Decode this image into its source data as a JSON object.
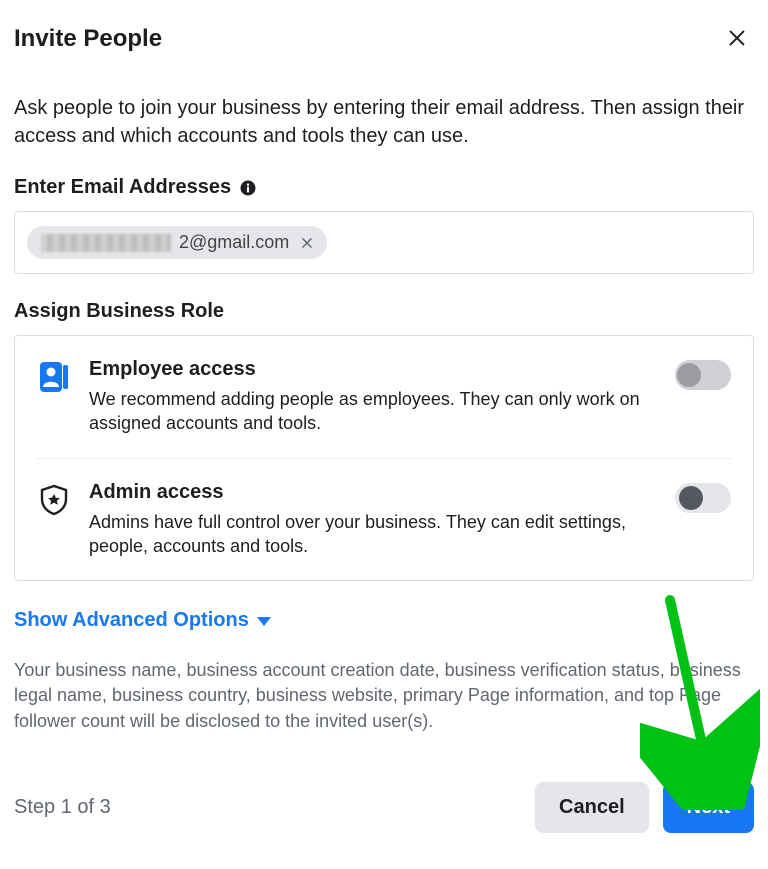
{
  "header": {
    "title": "Invite People"
  },
  "description": "Ask people to join your business by entering their email address. Then assign their access and which accounts and tools they can use.",
  "email_section": {
    "label": "Enter Email Addresses",
    "chip_suffix": "2@gmail.com"
  },
  "role_section": {
    "label": "Assign Business Role",
    "employee": {
      "title": "Employee access",
      "desc": "We recommend adding people as employees. They can only work on assigned accounts and tools."
    },
    "admin": {
      "title": "Admin access",
      "desc": "Admins have full control over your business. They can edit settings, people, accounts and tools."
    }
  },
  "advanced_label": "Show Advanced Options",
  "disclosure": "Your business name, business account creation date, business verification status, business legal name, business country, business website, primary Page information, and top Page follower count will be disclosed to the invited user(s).",
  "footer": {
    "step": "Step 1 of 3",
    "cancel": "Cancel",
    "next": "Next"
  }
}
